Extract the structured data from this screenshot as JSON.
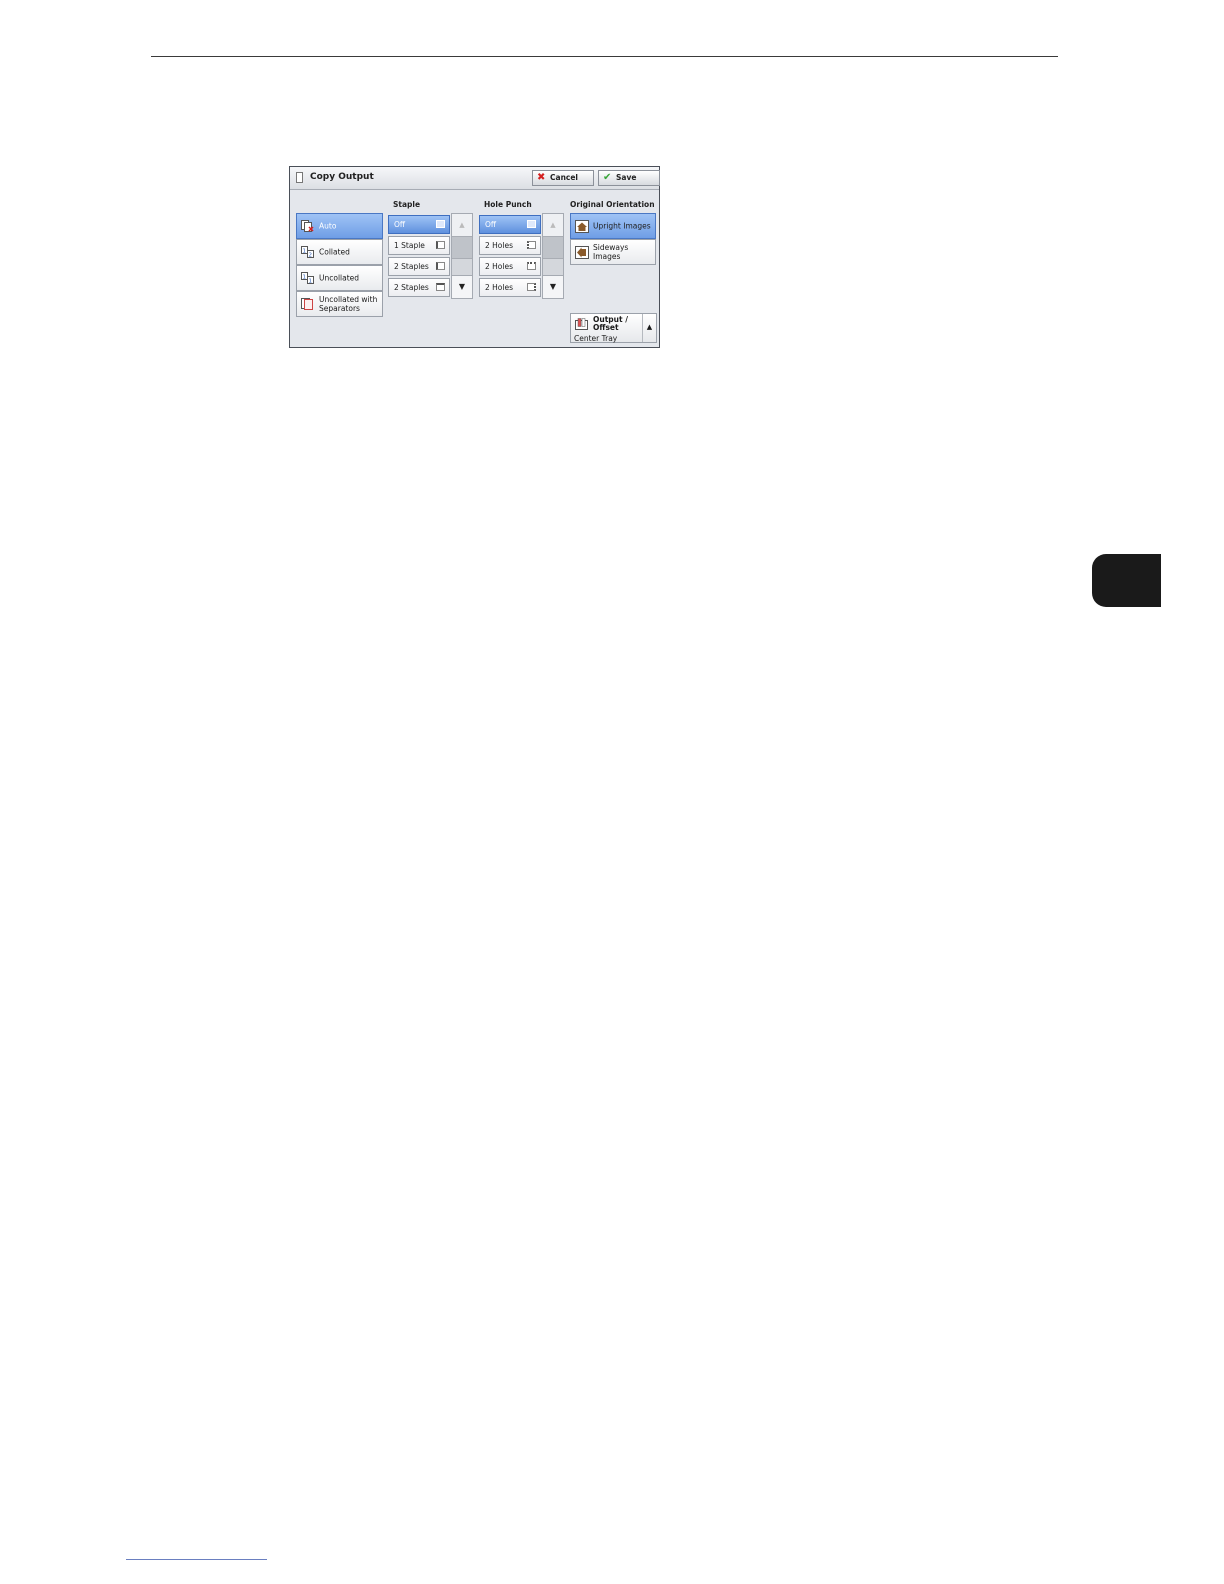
{
  "dialog": {
    "title": "Copy Output",
    "cancel_label": "Cancel",
    "save_label": "Save"
  },
  "output_mode": {
    "items": [
      {
        "label": "Auto",
        "selected": true
      },
      {
        "label": "Collated",
        "selected": false
      },
      {
        "label": "Uncollated",
        "selected": false
      },
      {
        "label": "Uncollated with Separators",
        "selected": false
      }
    ]
  },
  "staple": {
    "label": "Staple",
    "items": [
      {
        "label": "Off",
        "selected": true
      },
      {
        "label": "1 Staple",
        "selected": false
      },
      {
        "label": "2 Staples",
        "selected": false
      },
      {
        "label": "2 Staples",
        "selected": false
      }
    ]
  },
  "hole_punch": {
    "label": "Hole Punch",
    "items": [
      {
        "label": "Off",
        "selected": true
      },
      {
        "label": "2 Holes",
        "selected": false
      },
      {
        "label": "2 Holes",
        "selected": false
      },
      {
        "label": "2 Holes",
        "selected": false
      }
    ]
  },
  "orientation": {
    "label": "Original Orientation",
    "items": [
      {
        "label": "Upright Images",
        "selected": true
      },
      {
        "label": "Sideways Images",
        "selected": false
      }
    ]
  },
  "output_offset": {
    "title": "Output / Offset",
    "value": "Center Tray"
  },
  "colors": {
    "selected": "#6f9ee6",
    "panel": "#e4e7ec",
    "chapter_tab": "#1a1a1a"
  }
}
